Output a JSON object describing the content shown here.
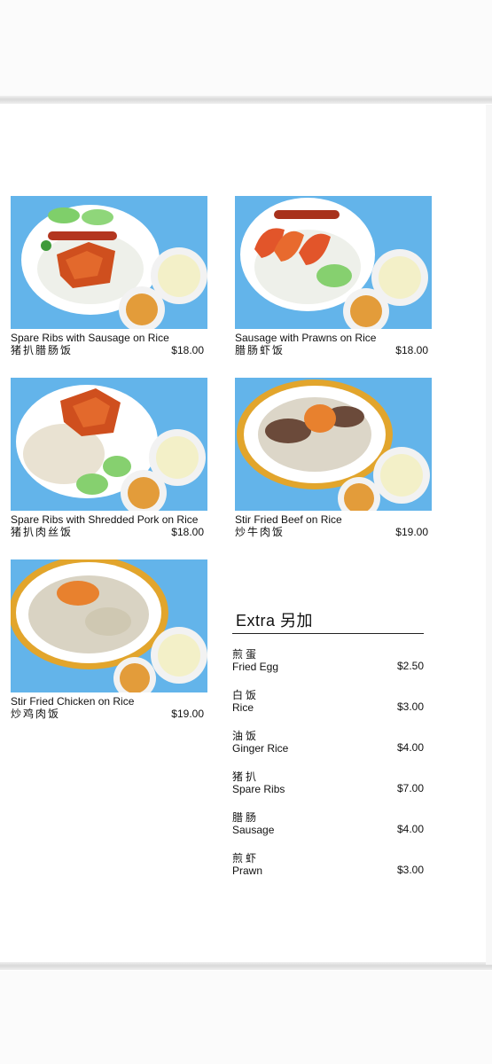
{
  "dishes": [
    {
      "name": "Spare Ribs with Sausage on Rice",
      "cn": "猪扒腊肠饭",
      "price": "$18.00"
    },
    {
      "name": "Sausage with Prawns on Rice",
      "cn": "腊肠虾饭",
      "price": "$18.00"
    },
    {
      "name": "Spare Ribs with Shredded Pork on Rice",
      "cn": "猪扒肉丝饭",
      "price": "$18.00"
    },
    {
      "name": "Stir Fried Beef on Rice",
      "cn": "炒牛肉饭",
      "price": "$19.00"
    },
    {
      "name": "Stir Fried Chicken on Rice",
      "cn": "炒鸡肉饭",
      "price": "$19.00"
    }
  ],
  "extra": {
    "title": "Extra 另加",
    "items": [
      {
        "cn": "煎蛋",
        "en": "Fried Egg",
        "price": "$2.50"
      },
      {
        "cn": "白饭",
        "en": "Rice",
        "price": "$3.00"
      },
      {
        "cn": "油饭",
        "en": "Ginger Rice",
        "price": "$4.00"
      },
      {
        "cn": "猪扒",
        "en": "Spare Ribs",
        "price": "$7.00"
      },
      {
        "cn": "腊肠",
        "en": "Sausage",
        "price": "$4.00"
      },
      {
        "cn": "煎虾",
        "en": "Prawn",
        "price": "$3.00"
      }
    ]
  },
  "colors": {
    "photo_background": "#63b4ea",
    "text": "#111111",
    "divider": "#d9d9d9"
  }
}
